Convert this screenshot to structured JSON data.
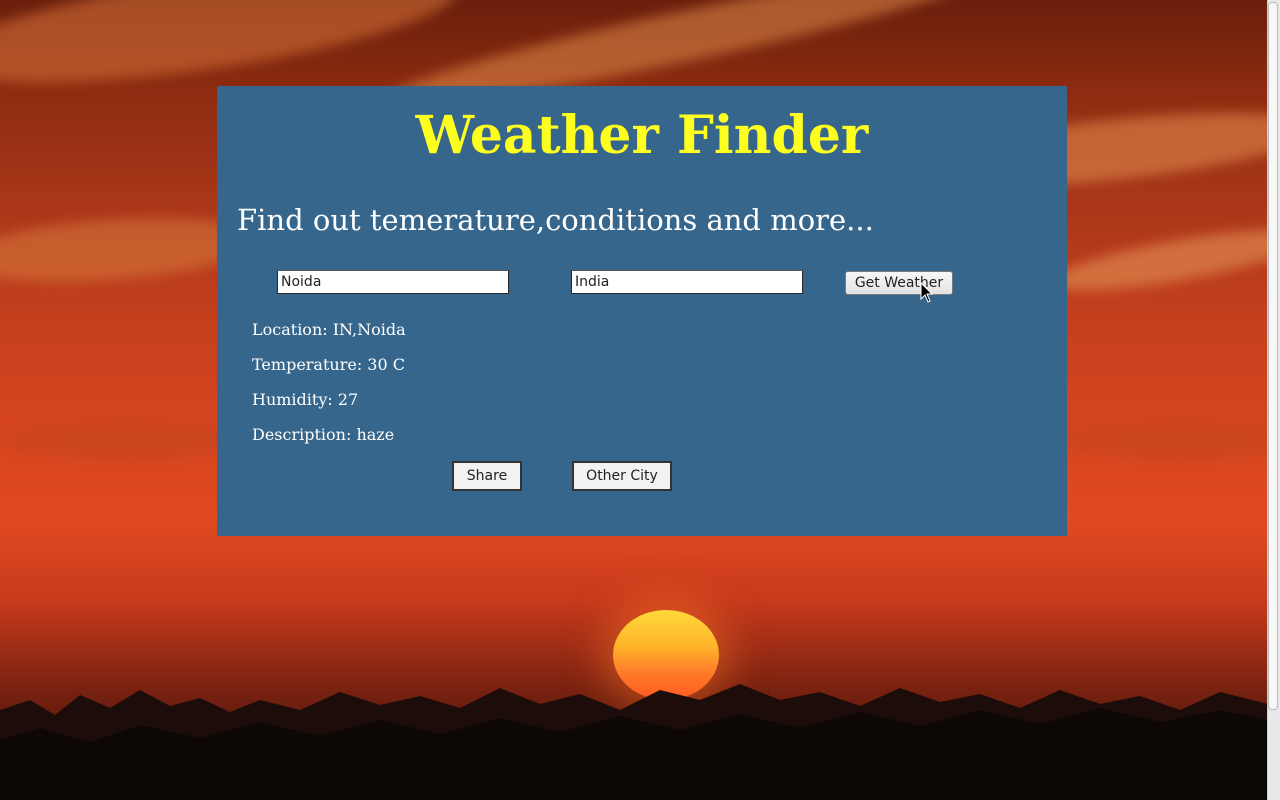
{
  "app": {
    "title": "Weather Finder",
    "subtitle": "Find out temerature,conditions and more..."
  },
  "form": {
    "city_value": "Noida",
    "country_value": "India",
    "get_weather_label": "Get Weather"
  },
  "result": {
    "location": "Location: IN,Noida",
    "temperature": "Temperature: 30 C",
    "humidity": "Humidity: 27",
    "description": "Description: haze"
  },
  "actions": {
    "share_label": "Share",
    "other_city_label": "Other City"
  },
  "colors": {
    "panel": "#36668c",
    "title": "#ffff1f",
    "text": "#ffffff"
  }
}
